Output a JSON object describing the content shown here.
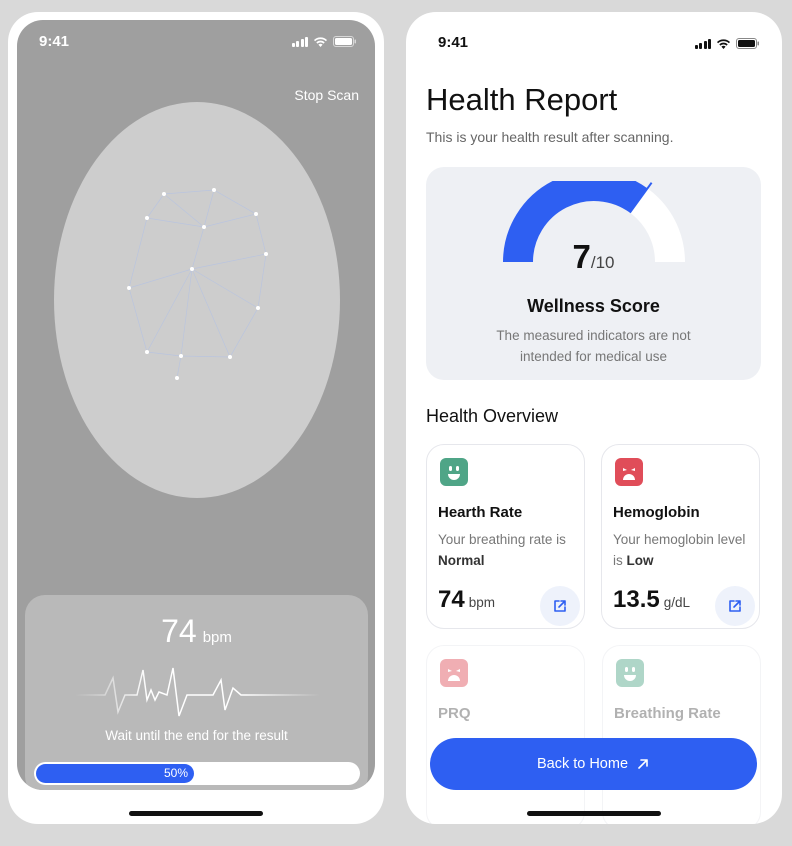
{
  "status": {
    "time": "9:41"
  },
  "scan": {
    "stop_label": "Stop Scan",
    "bpm_value": "74",
    "bpm_unit": "bpm",
    "wait_text": "Wait until the end for the result",
    "progress_fraction": 0.5,
    "progress_label": "50%"
  },
  "report": {
    "title": "Health Report",
    "subtitle": "This is your health result after scanning.",
    "score": {
      "value": "7",
      "max": "/10",
      "fraction": 0.7,
      "label": "Wellness Score",
      "note": "The measured indicators are not intended for medical use"
    },
    "overview_title": "Health Overview",
    "metrics": [
      {
        "title": "Hearth Rate",
        "desc": "Your breathing rate is",
        "status": "Normal",
        "value": "74",
        "unit": "bpm",
        "mood": "happy",
        "color": "#4fa587"
      },
      {
        "title": "Hemoglobin",
        "desc": "Your hemoglobin level is",
        "status": "Low",
        "value": "13.5",
        "unit": "g/dL",
        "mood": "sad",
        "color": "#e04d59"
      },
      {
        "title": "PRQ",
        "mood": "sad",
        "color": "#e04d59"
      },
      {
        "title": "Breathing Rate",
        "mood": "happy",
        "color": "#4fa587"
      }
    ],
    "back_label": "Back to Home"
  },
  "colors": {
    "accent": "#2e5ff2",
    "gauge_track": "#ffffff",
    "scan_bg": "#9f9f9f"
  }
}
